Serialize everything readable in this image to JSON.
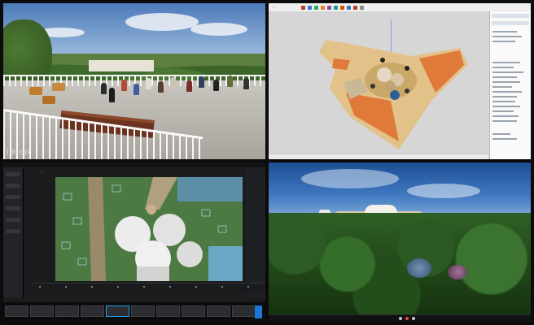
{
  "rooftop_render": {
    "watermark": "imion"
  },
  "modeling_app": {
    "title_bar": "...",
    "toolbar_button_colors": [
      "#c0392b",
      "#2c7bd6",
      "#27ae60",
      "#e67e22",
      "#8e44ad",
      "#16a085",
      "#d35400",
      "#2980b9",
      "#c0392b",
      "#7f8c8d"
    ]
  },
  "render_editor": {
    "tab_title": "...",
    "filmstrip": {
      "thumbnails": [
        {
          "label": "..."
        },
        {
          "label": "..."
        },
        {
          "label": "..."
        },
        {
          "label": "..."
        },
        {
          "label": "..."
        },
        {
          "label": ""
        },
        {
          "label": ""
        },
        {
          "label": ""
        },
        {
          "label": ""
        },
        {
          "label": ""
        }
      ],
      "active_index": 4
    }
  },
  "garden_render": {
    "status_text": "..."
  }
}
